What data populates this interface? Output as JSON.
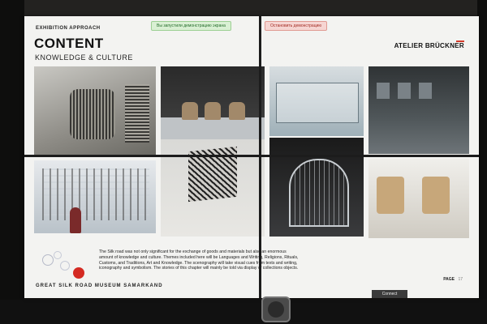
{
  "slide": {
    "eyebrow": "EXHIBITION APPROACH",
    "title": "CONTENT",
    "subtitle": "KNOWLEDGE & CULTURE",
    "brand": "ATELIER BRÜCKNER",
    "museum": "GREAT SILK ROAD MUSEUM SAMARKAND",
    "body": "The Silk road was not only significant for the exchange of goods and materials but also an enormous amount of knowledge and culture. Themes included here will be Languages and Writing, Religions, Rituals, Customs, and Traditions, Art and Knowledge. The scenography will take visual cues from texts and writing, iconography and symbolism. The stories of this chapter will mainly be told via display of collections objects.",
    "page_label": "PAGE",
    "page_number": "17"
  },
  "notifications": {
    "demo_started": "Вы запустили демонстрацию экрана",
    "stop_demo": "Остановить демонстрацию"
  },
  "taskbar": {
    "connect_label": "Connect"
  },
  "photos": [
    {
      "name": "photo-lattice-installation"
    },
    {
      "name": "photo-buddha-heads"
    },
    {
      "name": "photo-vitrine-objects"
    },
    {
      "name": "photo-dark-gallery"
    },
    {
      "name": "photo-script-wall"
    },
    {
      "name": "photo-lattice-cube"
    },
    {
      "name": "photo-wireframe-architecture"
    },
    {
      "name": "photo-textile-display"
    }
  ],
  "colors": {
    "accent_red": "#d42a22",
    "toast_green": "#d9f0d3",
    "toast_red": "#f6d5d2"
  }
}
